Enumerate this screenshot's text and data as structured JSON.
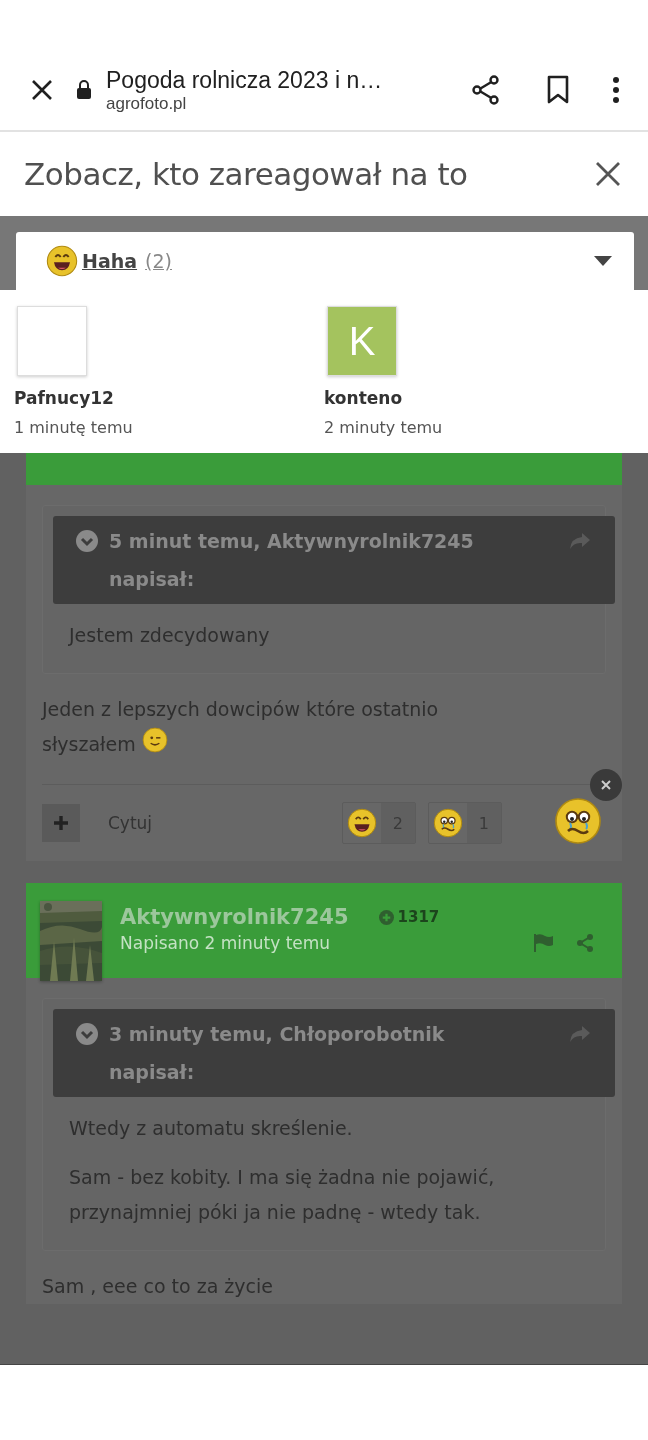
{
  "browser": {
    "title": "Pogoda rolnicza 2023 i n…",
    "url": "agrofoto.pl"
  },
  "dialog": {
    "title": "Zobacz, kto zareagował na to",
    "filter": {
      "kind": "haha",
      "label": "Haha",
      "count": "(2)"
    },
    "reactors": [
      {
        "name": "Pafnucy12",
        "time": "1 minutę temu",
        "avatar": {
          "kind": "blank"
        }
      },
      {
        "name": "konteno",
        "time": "2 minuty temu",
        "avatar": {
          "kind": "letter",
          "letter": "K",
          "color": "#a4c35e"
        }
      }
    ]
  },
  "posts": [
    {
      "quote": {
        "header": "5 minut temu, Aktywnyrolnik7245 napisał:",
        "paragraphs": [
          "Jestem zdecydowany"
        ]
      },
      "body": "Jeden z lepszych dowcipów które ostatnio słyszałem",
      "body_emoji": {
        "kind": "wink"
      },
      "footer": {
        "quote_label": "Cytuj",
        "reactions": [
          {
            "kind": "haha",
            "count": "2"
          },
          {
            "kind": "sad",
            "count": "1"
          }
        ],
        "my_reaction": {
          "kind": "sad"
        }
      }
    },
    {
      "author": "Aktywnyrolnik7245",
      "reputation": "1317",
      "posted": "Napisano 2 minuty temu",
      "quote": {
        "header": "3 minuty temu, Chłoporobotnik napisał:",
        "paragraphs": [
          "Wtedy z automatu skreślenie.",
          "Sam - bez kobity. I ma się żadna nie pojawić, przynajmniej póki ja nie padnę - wtedy tak."
        ]
      },
      "body": "Sam , eee co to za życie"
    }
  ]
}
